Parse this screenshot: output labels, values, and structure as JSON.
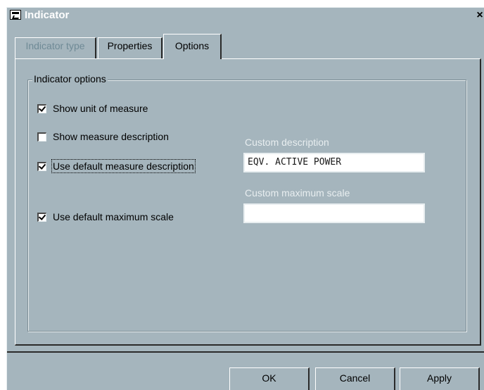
{
  "window": {
    "title": "Indicator",
    "close_symbol": "×"
  },
  "tabs": [
    {
      "label": "Indicator type",
      "state": "disabled"
    },
    {
      "label": "Properties",
      "state": "normal"
    },
    {
      "label": "Options",
      "state": "selected"
    }
  ],
  "group": {
    "legend": "Indicator options"
  },
  "options": {
    "show_unit": {
      "label": "Show unit of measure",
      "checked": true
    },
    "show_description": {
      "label": "Show measure description",
      "checked": false
    },
    "use_default_description": {
      "label": "Use default measure description",
      "checked": true
    },
    "use_default_max_scale": {
      "label": "Use default maximum scale",
      "checked": true
    }
  },
  "fields": {
    "custom_description": {
      "label": "Custom description",
      "value": "EQV. ACTIVE POWER"
    },
    "custom_max_scale": {
      "label": "Custom maximum scale",
      "value": ""
    }
  },
  "buttons": {
    "ok": "OK",
    "cancel": "Cancel",
    "apply": "Apply"
  },
  "colors": {
    "window_bg": "#a5b5bd",
    "disabled_text": "#6f8a96",
    "field_label": "#e8eef0"
  }
}
